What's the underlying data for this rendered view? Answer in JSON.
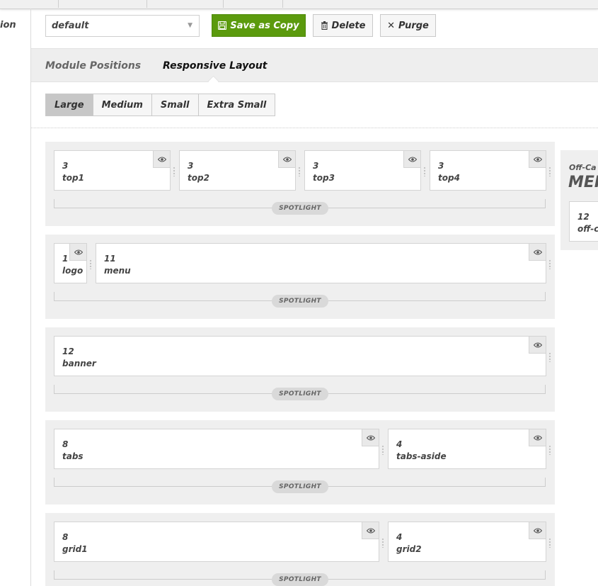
{
  "sidebar": {
    "label_fragment": "ion"
  },
  "toolbar": {
    "layout_select": {
      "value": "default"
    },
    "save_copy_label": "Save as Copy",
    "delete_label": "Delete",
    "purge_label": "Purge"
  },
  "tabs": [
    {
      "label": "Module Positions",
      "active": false
    },
    {
      "label": "Responsive Layout",
      "active": true
    }
  ],
  "devices": [
    {
      "label": "Large",
      "active": true
    },
    {
      "label": "Medium",
      "active": false
    },
    {
      "label": "Small",
      "active": false
    },
    {
      "label": "Extra Small",
      "active": false
    }
  ],
  "sections": [
    {
      "label": "SPOTLIGHT",
      "blocks": [
        {
          "width": "3",
          "name": "top1"
        },
        {
          "width": "3",
          "name": "top2"
        },
        {
          "width": "3",
          "name": "top3"
        },
        {
          "width": "3",
          "name": "top4"
        }
      ]
    },
    {
      "label": "SPOTLIGHT",
      "blocks": [
        {
          "width": "1",
          "name": "logo"
        },
        {
          "width": "11",
          "name": "menu"
        }
      ]
    },
    {
      "label": "SPOTLIGHT",
      "blocks": [
        {
          "width": "12",
          "name": "banner"
        }
      ]
    },
    {
      "label": "SPOTLIGHT",
      "blocks": [
        {
          "width": "8",
          "name": "tabs"
        },
        {
          "width": "4",
          "name": "tabs-aside"
        }
      ]
    },
    {
      "label": "SPOTLIGHT",
      "blocks": [
        {
          "width": "8",
          "name": "grid1"
        },
        {
          "width": "4",
          "name": "grid2"
        }
      ]
    }
  ],
  "offcanvas": {
    "title": "Off-Ca",
    "heading": "MEI",
    "block": {
      "width": "12",
      "name": "off-c"
    }
  },
  "colors": {
    "accent_green": "#5b9a0d",
    "panel_gray": "#efefef",
    "active_device": "#c7c7c7"
  }
}
